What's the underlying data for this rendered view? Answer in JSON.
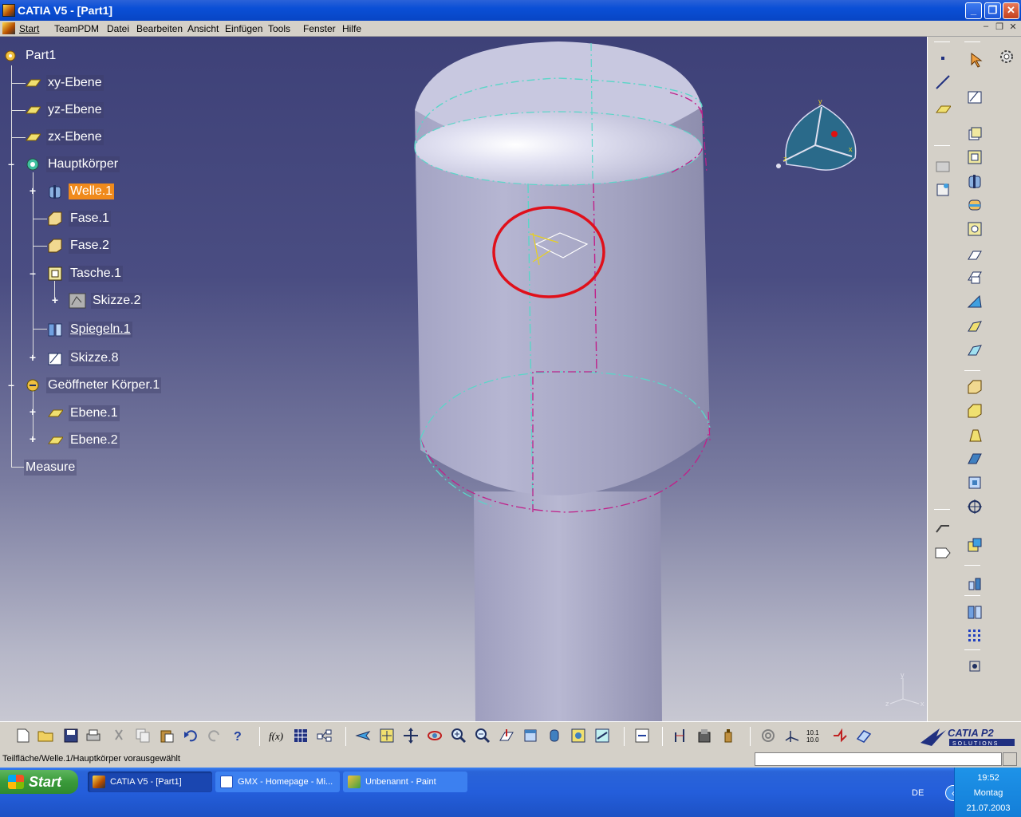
{
  "window": {
    "title": "CATIA V5 - [Part1]"
  },
  "menu": {
    "items": [
      "Start",
      "TeamPDM",
      "Datei",
      "Bearbeiten",
      "Ansicht",
      "Einfügen",
      "Tools",
      "Fenster",
      "Hilfe"
    ]
  },
  "tree": {
    "root": "Part1",
    "xy": "xy-Ebene",
    "yz": "yz-Ebene",
    "zx": "zx-Ebene",
    "body": "Hauptkörper",
    "welle": "Welle.1",
    "fase1": "Fase.1",
    "fase2": "Fase.2",
    "tasche": "Tasche.1",
    "skizze2": "Skizze.2",
    "spiegeln": "Spiegeln.1",
    "skizze8": "Skizze.8",
    "open_body": "Geöffneter Körper.1",
    "ebene1": "Ebene.1",
    "ebene2": "Ebene.2",
    "measure": "Measure"
  },
  "compass": {
    "axis_x": "x",
    "axis_y": "y",
    "axis_z": "z"
  },
  "axis_triad": {
    "x": "x",
    "y": "y",
    "z": "z"
  },
  "status": {
    "message": "Teilfläche/Welle.1/Hauptkörper vorausgewählt",
    "command_value": ""
  },
  "brand": {
    "logo_text": "CATIA P2",
    "logo_sub": "SOLUTIONS"
  },
  "taskbar": {
    "start_label": "Start",
    "tasks": [
      "CATIA V5 - [Part1]",
      "GMX - Homepage - Mi...",
      "Unbenannt - Paint"
    ],
    "language": "DE",
    "time": "19:52",
    "day": "Montag",
    "date": "21.07.2003"
  },
  "colors": {
    "selection": "#f08a1c",
    "highlight_circle": "#e0101a",
    "background_top": "#3e4178"
  }
}
